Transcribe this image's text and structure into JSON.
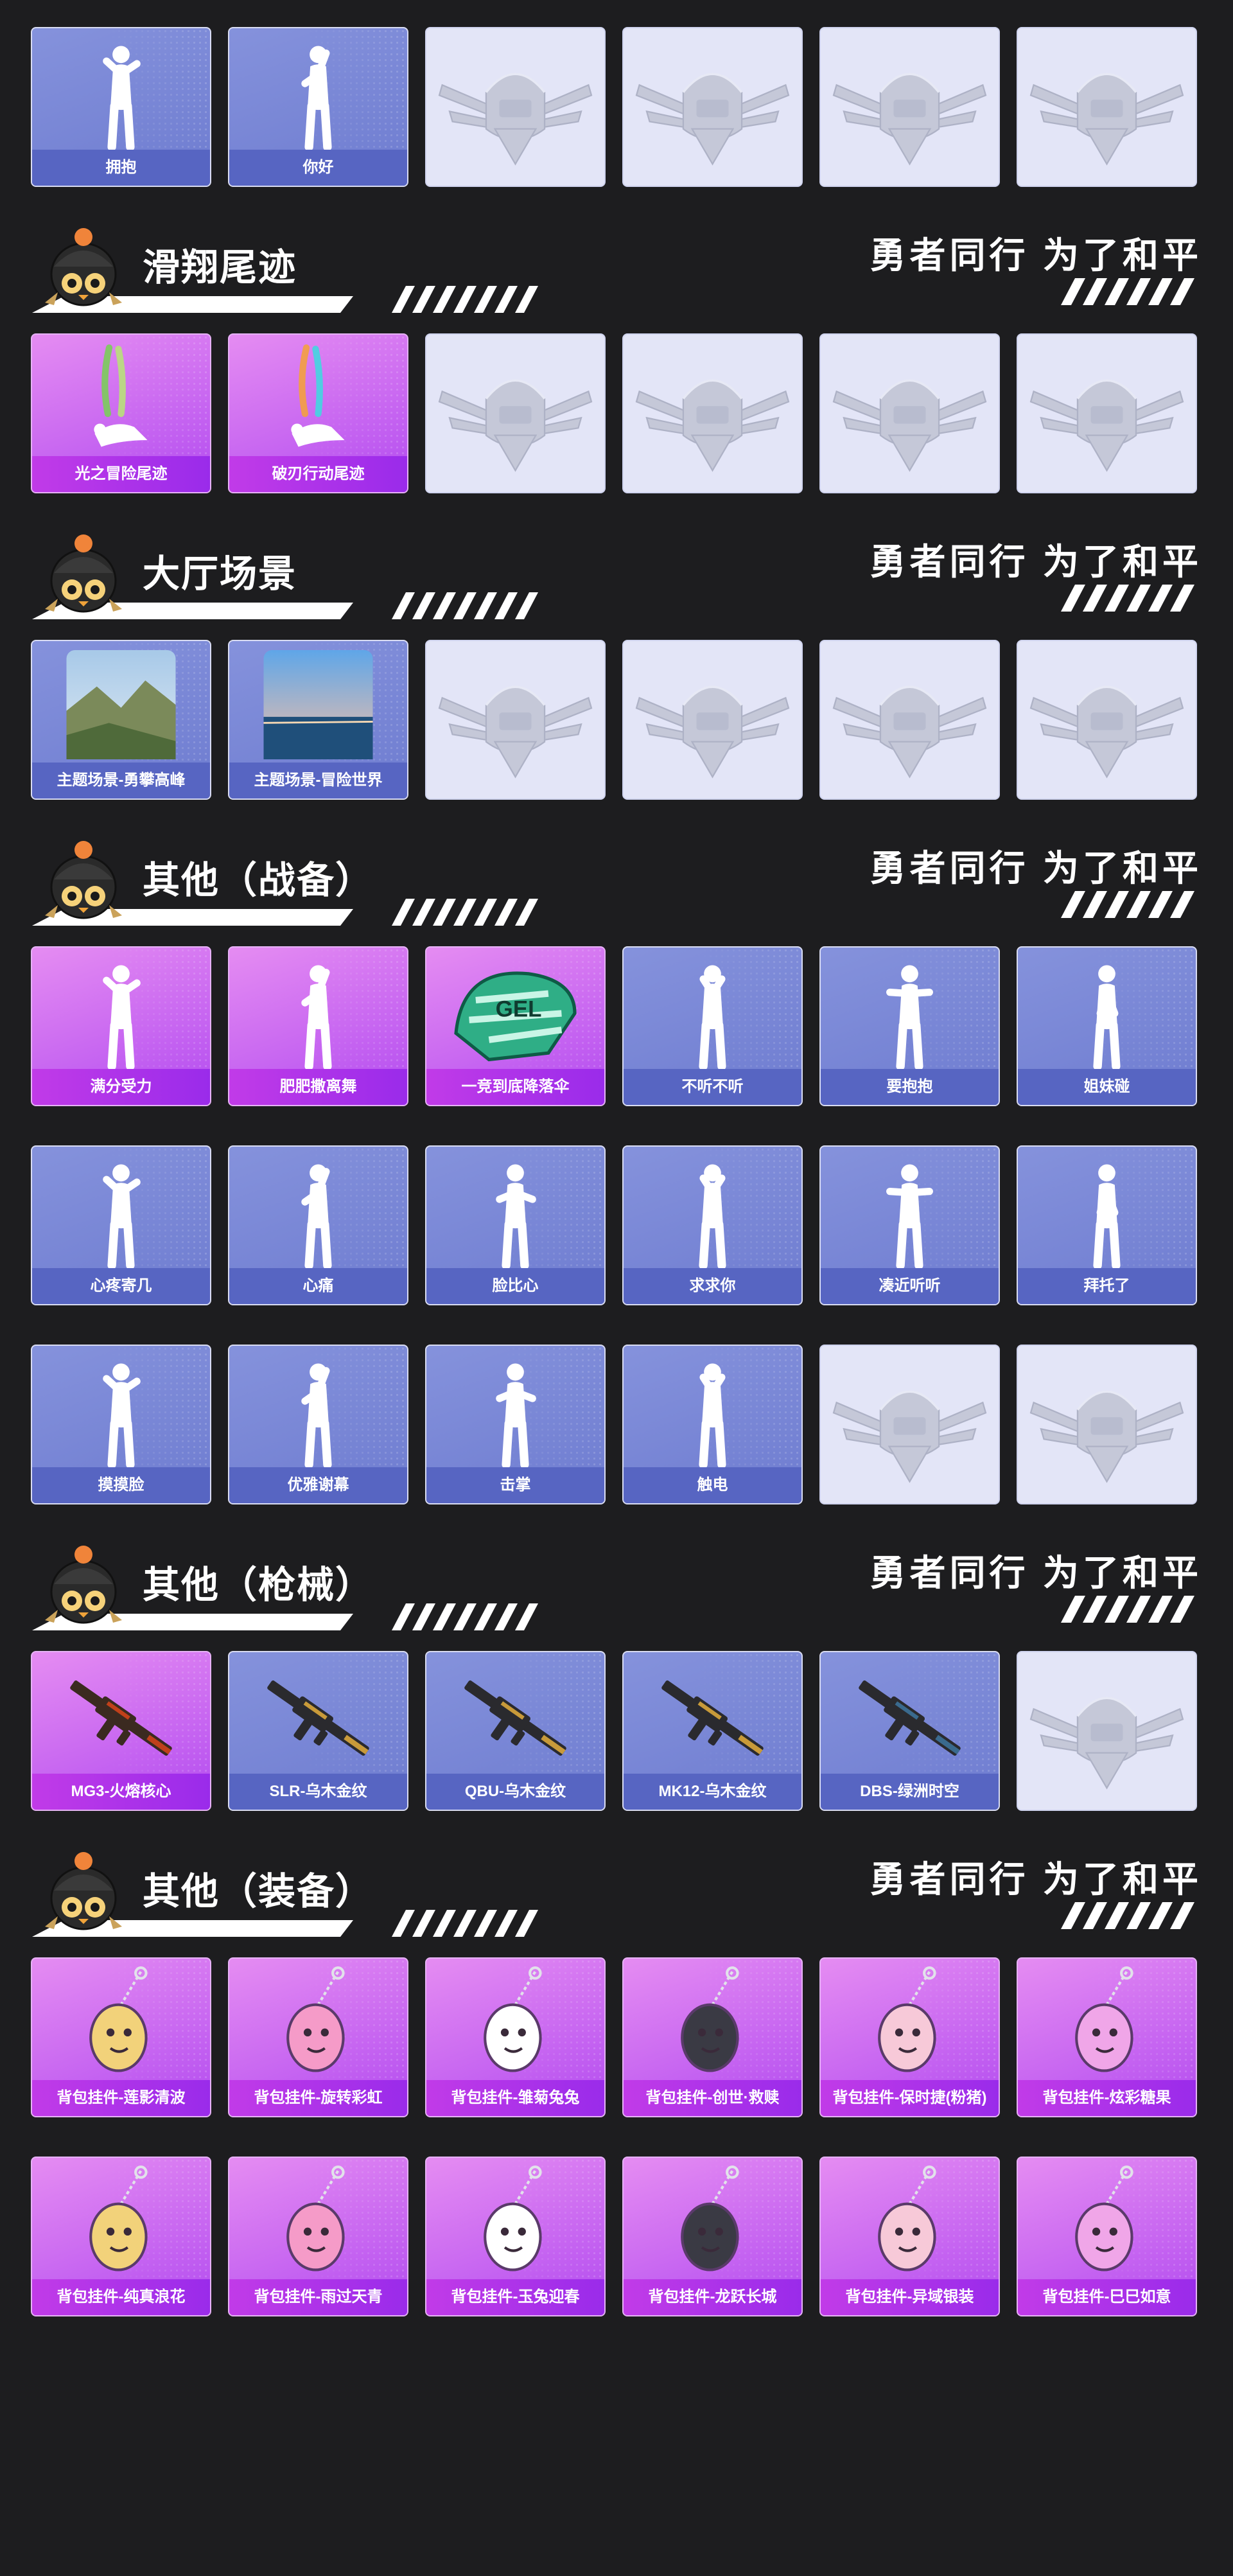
{
  "slogan": "勇者同行 为了和平",
  "rows_top": [
    {
      "items": [
        {
          "type": "blue",
          "art": "emote-figure-icon",
          "label": "拥抱"
        },
        {
          "type": "blue",
          "art": "emote-figure-icon",
          "label": "你好"
        },
        {
          "type": "empty",
          "art": "placeholder-emblem-icon",
          "label": ""
        },
        {
          "type": "empty",
          "art": "placeholder-emblem-icon",
          "label": ""
        },
        {
          "type": "empty",
          "art": "placeholder-emblem-icon",
          "label": ""
        },
        {
          "type": "empty",
          "art": "placeholder-emblem-icon",
          "label": ""
        }
      ]
    }
  ],
  "sections": [
    {
      "title": "滑翔尾迹",
      "rows": [
        {
          "items": [
            {
              "type": "purple",
              "art": "glide-trail-icon",
              "label": "光之冒险尾迹"
            },
            {
              "type": "purple",
              "art": "glide-trail-icon",
              "label": "破刃行动尾迹"
            },
            {
              "type": "empty",
              "art": "placeholder-emblem-icon",
              "label": ""
            },
            {
              "type": "empty",
              "art": "placeholder-emblem-icon",
              "label": ""
            },
            {
              "type": "empty",
              "art": "placeholder-emblem-icon",
              "label": ""
            },
            {
              "type": "empty",
              "art": "placeholder-emblem-icon",
              "label": ""
            }
          ]
        }
      ]
    },
    {
      "title": "大厅场景",
      "rows": [
        {
          "items": [
            {
              "type": "blue",
              "art": "lobby-scene-mountain-icon",
              "label": "主题场景-勇攀高峰"
            },
            {
              "type": "blue",
              "art": "lobby-scene-sea-icon",
              "label": "主题场景-冒险世界"
            },
            {
              "type": "empty",
              "art": "placeholder-emblem-icon",
              "label": ""
            },
            {
              "type": "empty",
              "art": "placeholder-emblem-icon",
              "label": ""
            },
            {
              "type": "empty",
              "art": "placeholder-emblem-icon",
              "label": ""
            },
            {
              "type": "empty",
              "art": "placeholder-emblem-icon",
              "label": ""
            }
          ]
        }
      ]
    },
    {
      "title": "其他（战备）",
      "rows": [
        {
          "items": [
            {
              "type": "purple",
              "art": "emote-figure-icon",
              "label": "满分受力"
            },
            {
              "type": "purple",
              "art": "emote-figure-icon",
              "label": "肥肥撒离舞"
            },
            {
              "type": "purple",
              "art": "parachute-icon",
              "label": "一竞到底降落伞"
            },
            {
              "type": "blue",
              "art": "emote-figure-icon",
              "label": "不听不听"
            },
            {
              "type": "blue",
              "art": "emote-figure-icon",
              "label": "要抱抱"
            },
            {
              "type": "blue",
              "art": "emote-figure-icon",
              "label": "姐妹碰"
            }
          ]
        },
        {
          "items": [
            {
              "type": "blue",
              "art": "emote-figure-icon",
              "label": "心疼寄几"
            },
            {
              "type": "blue",
              "art": "emote-figure-icon",
              "label": "心痛"
            },
            {
              "type": "blue",
              "art": "emote-figure-icon",
              "label": "脸比心"
            },
            {
              "type": "blue",
              "art": "emote-figure-icon",
              "label": "求求你"
            },
            {
              "type": "blue",
              "art": "emote-figure-icon",
              "label": "凑近听听"
            },
            {
              "type": "blue",
              "art": "emote-figure-icon",
              "label": "拜托了"
            }
          ]
        },
        {
          "items": [
            {
              "type": "blue",
              "art": "emote-figure-icon",
              "label": "摸摸脸"
            },
            {
              "type": "blue",
              "art": "emote-figure-icon",
              "label": "优雅谢幕"
            },
            {
              "type": "blue",
              "art": "emote-figure-icon",
              "label": "击掌"
            },
            {
              "type": "blue",
              "art": "emote-figure-icon",
              "label": "触电"
            },
            {
              "type": "empty",
              "art": "placeholder-emblem-icon",
              "label": ""
            },
            {
              "type": "empty",
              "art": "placeholder-emblem-icon",
              "label": ""
            }
          ]
        }
      ]
    },
    {
      "title": "其他（枪械）",
      "rows": [
        {
          "items": [
            {
              "type": "purple",
              "art": "gun-icon",
              "label": "MG3-火熔核心"
            },
            {
              "type": "blue",
              "art": "gun-icon",
              "label": "SLR-乌木金纹"
            },
            {
              "type": "blue",
              "art": "gun-icon",
              "label": "QBU-乌木金纹"
            },
            {
              "type": "blue",
              "art": "gun-icon",
              "label": "MK12-乌木金纹"
            },
            {
              "type": "blue",
              "art": "gun-icon",
              "label": "DBS-绿洲时空"
            },
            {
              "type": "empty",
              "art": "placeholder-emblem-icon",
              "label": ""
            }
          ]
        }
      ]
    },
    {
      "title": "其他（装备）",
      "rows": [
        {
          "items": [
            {
              "type": "purple",
              "art": "bag-pendant-icon",
              "label": "背包挂件-莲影清波"
            },
            {
              "type": "purple",
              "art": "bag-pendant-icon",
              "label": "背包挂件-旋转彩虹"
            },
            {
              "type": "purple",
              "art": "bag-pendant-icon",
              "label": "背包挂件-雏菊兔兔"
            },
            {
              "type": "purple",
              "art": "bag-pendant-icon",
              "label": "背包挂件-创世·救赎"
            },
            {
              "type": "purple",
              "art": "bag-pendant-icon",
              "label": "背包挂件-保时捷(粉猪)"
            },
            {
              "type": "purple",
              "art": "bag-pendant-icon",
              "label": "背包挂件-炫彩糖果"
            }
          ]
        },
        {
          "items": [
            {
              "type": "purple",
              "art": "bag-pendant-icon",
              "label": "背包挂件-纯真浪花"
            },
            {
              "type": "purple",
              "art": "bag-pendant-icon",
              "label": "背包挂件-雨过天青"
            },
            {
              "type": "purple",
              "art": "bag-pendant-icon",
              "label": "背包挂件-玉兔迎春"
            },
            {
              "type": "purple",
              "art": "bag-pendant-icon",
              "label": "背包挂件-龙跃长城"
            },
            {
              "type": "purple",
              "art": "bag-pendant-icon",
              "label": "背包挂件-异域银装"
            },
            {
              "type": "purple",
              "art": "bag-pendant-icon",
              "label": "背包挂件-巳巳如意"
            }
          ]
        }
      ]
    }
  ]
}
